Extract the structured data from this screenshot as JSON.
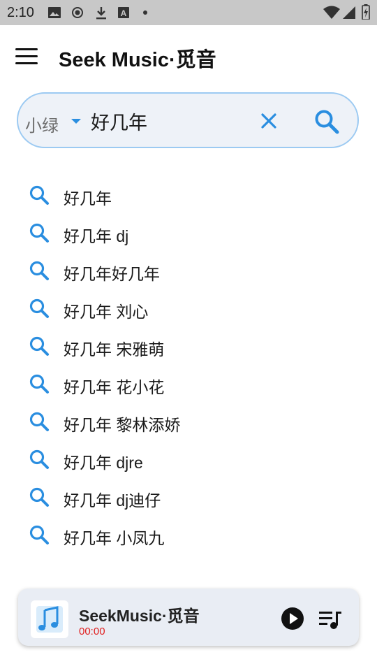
{
  "status_bar": {
    "time": "2:10",
    "left_icons": [
      "image-icon",
      "record-icon",
      "download-icon",
      "font-icon",
      "dot-icon"
    ],
    "right_icons": [
      "wifi-icon",
      "signal-icon",
      "battery-icon"
    ]
  },
  "app_bar": {
    "menu_icon": "hamburger-menu-icon",
    "title": "Seek Music·觅音"
  },
  "search": {
    "source": "小绿",
    "query": "好几年",
    "clear_icon": "close-icon",
    "search_icon": "search-icon",
    "accent_color": "#2a8ee0"
  },
  "suggestions": [
    {
      "text": "好几年"
    },
    {
      "text": "好几年 dj"
    },
    {
      "text": "好几年好几年"
    },
    {
      "text": "好几年 刘心"
    },
    {
      "text": "好几年 宋雅萌"
    },
    {
      "text": "好几年 花小花"
    },
    {
      "text": "好几年 黎林添娇"
    },
    {
      "text": "好几年 djre"
    },
    {
      "text": "好几年 dj迪仔"
    },
    {
      "text": "好几年 小凤九"
    }
  ],
  "player": {
    "title": "SeekMusic·觅音",
    "time": "00:00",
    "time_color": "#e02020",
    "cover_icon": "music-note-icon",
    "play_icon": "play-icon",
    "queue_icon": "playlist-icon"
  }
}
